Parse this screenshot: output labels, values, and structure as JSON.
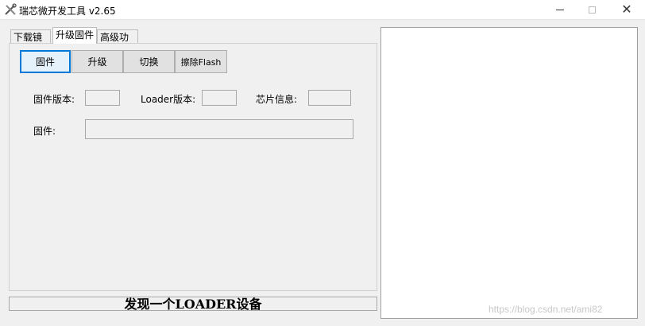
{
  "window": {
    "title": "瑞芯微开发工具 v2.65",
    "app_icon": "tools-icon",
    "close_glyph": "✕"
  },
  "tabs": [
    {
      "label": "下载镜像",
      "active": false
    },
    {
      "label": "升级固件",
      "active": true
    },
    {
      "label": "高级功能",
      "active": false
    }
  ],
  "toolbar": {
    "firmware_button": "固件",
    "upgrade_button": "升级",
    "switch_button": "切换",
    "erase_button": "擦除Flash"
  },
  "info": {
    "firmware_version_label": "固件版本:",
    "firmware_version_value": "",
    "loader_version_label": "Loader版本:",
    "loader_version_value": "",
    "chip_info_label": "芯片信息:",
    "chip_info_value": "",
    "firmware_label": "固件:",
    "firmware_path_value": ""
  },
  "status": {
    "message": "发现一个LOADER设备"
  },
  "watermark": "https://blog.csdn.net/ami82",
  "colors": {
    "focus_border": "#0078d7",
    "background": "#f0f0f0",
    "log_background": "#ffffff"
  }
}
